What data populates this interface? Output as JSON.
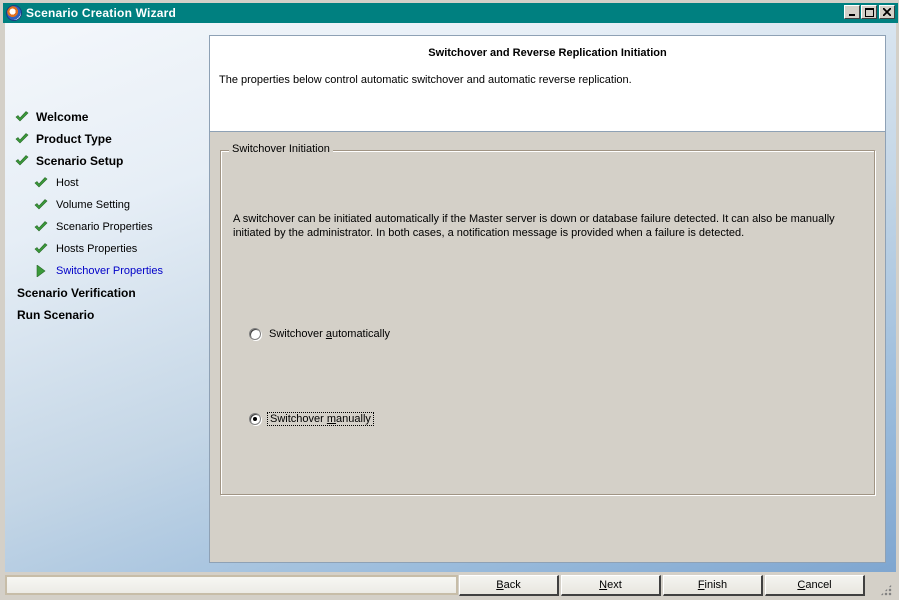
{
  "window": {
    "title": "Scenario Creation Wizard",
    "controls": {
      "minimize": "_",
      "maximize": "□",
      "close": "×"
    }
  },
  "nav": {
    "items": [
      {
        "label": "Welcome",
        "level": "major",
        "status": "done"
      },
      {
        "label": "Product Type",
        "level": "major",
        "status": "done"
      },
      {
        "label": "Scenario Setup",
        "level": "major",
        "status": "done"
      },
      {
        "label": "Host",
        "level": "minor",
        "status": "done"
      },
      {
        "label": "Volume Setting",
        "level": "minor",
        "status": "done"
      },
      {
        "label": "Scenario Properties",
        "level": "minor",
        "status": "done"
      },
      {
        "label": "Hosts Properties",
        "level": "minor",
        "status": "done"
      },
      {
        "label": "Switchover Properties",
        "level": "minor",
        "status": "current"
      },
      {
        "label": "Scenario Verification",
        "level": "major",
        "status": "pending"
      },
      {
        "label": "Run Scenario",
        "level": "major",
        "status": "pending"
      }
    ]
  },
  "header": {
    "title": "Switchover and Reverse Replication Initiation",
    "description": "The properties below control automatic switchover and automatic reverse replication."
  },
  "group": {
    "legend": "Switchover Initiation",
    "description": "A switchover can be initiated automatically if the Master server is down or database failure detected. It can also be manually initiated by the administrator. In both cases, a notification message is provided when a failure is detected.",
    "options": [
      {
        "pre": "Switchover ",
        "accel": "a",
        "post": "utomatically",
        "checked": false
      },
      {
        "pre": "Switchover ",
        "accel": "m",
        "post": "anually",
        "checked": true
      }
    ]
  },
  "buttons": {
    "back": {
      "accel": "B",
      "rest": "ack"
    },
    "next": {
      "accel": "N",
      "rest": "ext"
    },
    "finish": {
      "accel": "F",
      "rest": "inish"
    },
    "cancel": {
      "accel": "C",
      "rest": "ancel"
    }
  },
  "colors": {
    "titlebar": "#008080",
    "check_green": "#3a9a3a",
    "current_step": "#0000c8"
  }
}
